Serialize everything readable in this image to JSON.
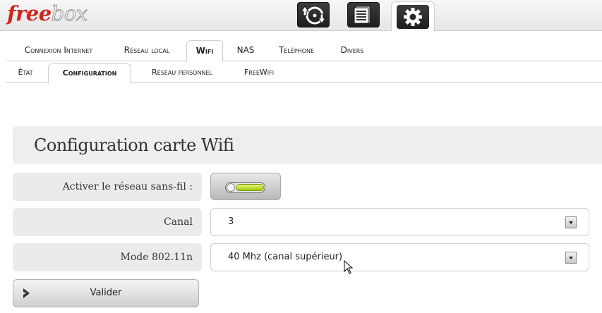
{
  "header": {
    "logo_free": "free",
    "logo_box": "box",
    "apps": [
      {
        "icon": "download-icon"
      },
      {
        "icon": "files-icon"
      },
      {
        "icon": "gear-icon",
        "active": true
      }
    ]
  },
  "tabs": [
    {
      "label": "Connexion Internet"
    },
    {
      "label": "Réseau local"
    },
    {
      "label": "Wifi",
      "active": true
    },
    {
      "label": "NAS"
    },
    {
      "label": "Téléphone"
    },
    {
      "label": "Divers"
    }
  ],
  "subtabs": [
    {
      "label": "État"
    },
    {
      "label": "Configuration",
      "active": true
    },
    {
      "label": "Réseau personnel"
    },
    {
      "label": "FreeWifi"
    }
  ],
  "panel": {
    "title": "Configuration carte Wifi",
    "enable_label": "Activer le réseau sans-fil :",
    "enable_state": true,
    "canal_label": "Canal",
    "canal_value": "3",
    "mode_label": "Mode 802.11n",
    "mode_value": "40 Mhz (canal supérieur)",
    "submit_label": "Valider"
  },
  "colors": {
    "brand_red": "#d0241c",
    "toggle_on": "#9bc812"
  }
}
